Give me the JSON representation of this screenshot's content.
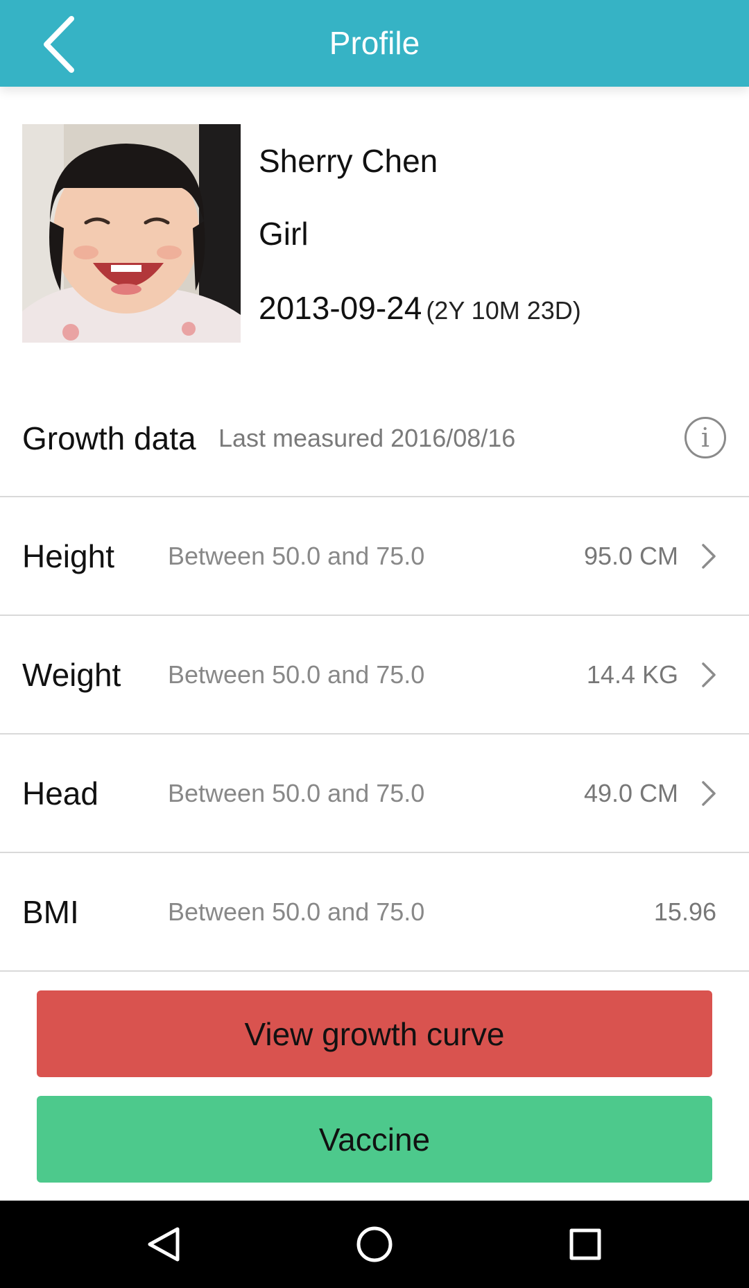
{
  "app_bar": {
    "title": "Profile",
    "back_icon": "chevron-left-icon",
    "background_color": "#36b3c5"
  },
  "profile": {
    "photo_icon": "child-photo",
    "name": "Sherry Chen",
    "gender": "Girl",
    "birth_date": "2013-09-24",
    "age": "(2Y 10M 23D)"
  },
  "growth": {
    "title": "Growth data",
    "last_measured": "Last measured 2016/08/16",
    "info_icon": "info-icon",
    "rows": [
      {
        "label": "Height",
        "range": "Between 50.0 and 75.0",
        "value": "95.0 CM",
        "has_chevron": true
      },
      {
        "label": "Weight",
        "range": "Between 50.0 and 75.0",
        "value": "14.4 KG",
        "has_chevron": true
      },
      {
        "label": "Head",
        "range": "Between 50.0 and 75.0",
        "value": "49.0 CM",
        "has_chevron": true
      },
      {
        "label": "BMI",
        "range": "Between 50.0 and 75.0",
        "value": "15.96",
        "has_chevron": false
      }
    ]
  },
  "actions": {
    "growth_curve_label": "View growth curve",
    "growth_curve_color": "#d9534f",
    "vaccine_label": "Vaccine",
    "vaccine_color": "#4dc98c"
  },
  "nav_bar": {
    "back_icon": "triangle-back-icon",
    "home_icon": "circle-home-icon",
    "recents_icon": "square-recents-icon"
  }
}
